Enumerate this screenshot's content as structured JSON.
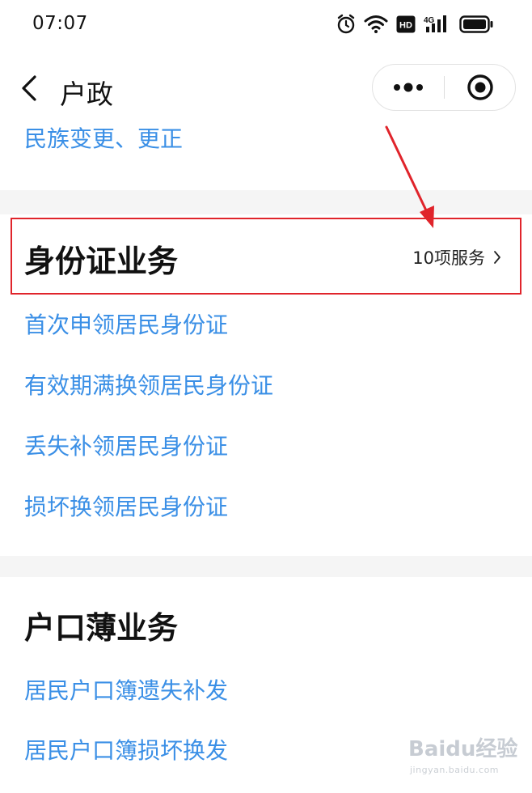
{
  "status_bar": {
    "time": "07:07",
    "icons": [
      "alarm-icon",
      "wifi-icon",
      "hd-icon",
      "signal-4g-icon",
      "battery-icon"
    ],
    "hd_label": "HD",
    "network_label": "4G"
  },
  "nav": {
    "title": "户政",
    "back_icon": "chevron-left-icon",
    "capsule_more_icon": "more-dots-icon",
    "capsule_close_icon": "target-icon"
  },
  "top_section": {
    "items": [
      "民族变更、更正"
    ]
  },
  "id_card_section": {
    "title": "身份证业务",
    "more_label": "10项服务",
    "items": [
      "首次申领居民身份证",
      "有效期满换领居民身份证",
      "丢失补领居民身份证",
      "损坏换领居民身份证"
    ]
  },
  "hukou_section": {
    "title": "户口薄业务",
    "items": [
      "居民户口簿遗失补发",
      "居民户口簿损坏换发"
    ]
  },
  "annotation": {
    "highlight_color": "#e0242b"
  },
  "watermark": {
    "logo_text": "Baidu经验",
    "sub_text": "jingyan.baidu.com"
  },
  "colors": {
    "link": "#3a8fe6",
    "separator": "#f5f5f5",
    "text": "#111111"
  }
}
